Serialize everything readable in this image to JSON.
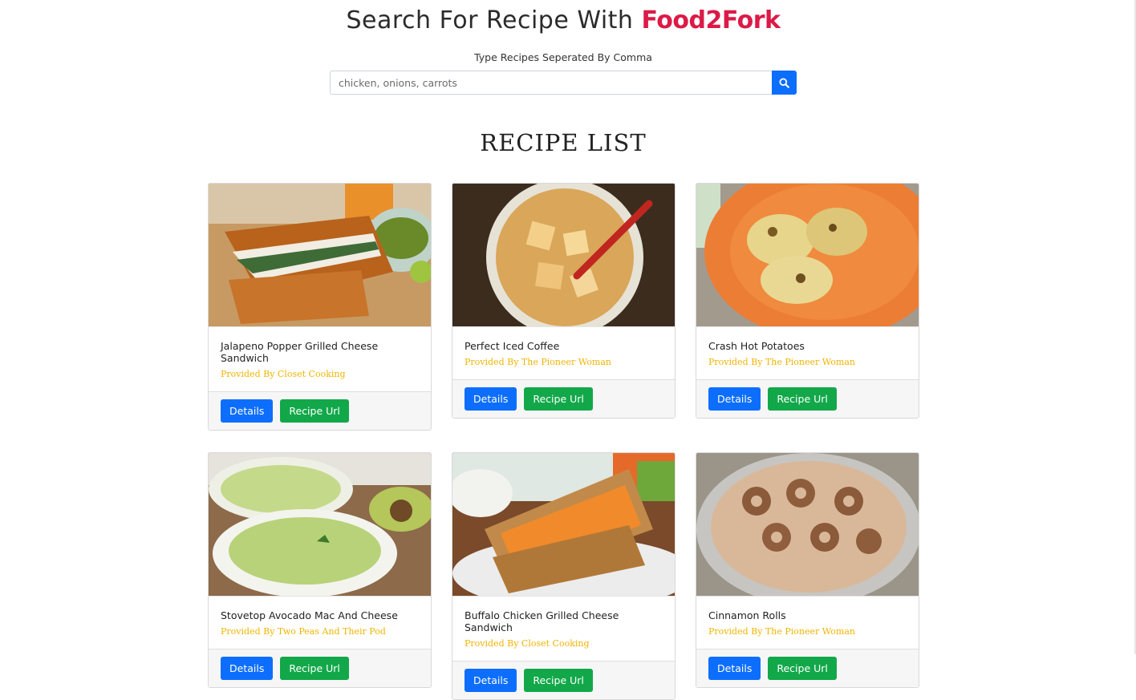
{
  "header": {
    "title_prefix": "Search For Recipe With",
    "brand": "Food2Fork",
    "search_label": "Type Recipes Seperated By Comma",
    "search_placeholder": "chicken, onions, carrots",
    "search_icon": "search-icon"
  },
  "list_title": "RECIPE LIST",
  "recipes": [
    {
      "title": "Jalapeno Popper Grilled Cheese Sandwich",
      "publisher": "Provided By Closet Cooking",
      "details_label": "Details",
      "url_label": "Recipe Url"
    },
    {
      "title": "Perfect Iced Coffee",
      "publisher": "Provided By The Pioneer Woman",
      "details_label": "Details",
      "url_label": "Recipe Url"
    },
    {
      "title": "Crash Hot Potatoes",
      "publisher": "Provided By The Pioneer Woman",
      "details_label": "Details",
      "url_label": "Recipe Url"
    },
    {
      "title": "Stovetop Avocado Mac And Cheese",
      "publisher": "Provided By Two Peas And Their Pod",
      "details_label": "Details",
      "url_label": "Recipe Url"
    },
    {
      "title": "Buffalo Chicken Grilled Cheese Sandwich",
      "publisher": "Provided By Closet Cooking",
      "details_label": "Details",
      "url_label": "Recipe Url"
    },
    {
      "title": "Cinnamon Rolls",
      "publisher": "Provided By The Pioneer Woman",
      "details_label": "Details",
      "url_label": "Recipe Url"
    }
  ],
  "colors": {
    "brand": "#dc1a47",
    "primary_button": "#0d6efd",
    "success_button": "#12a84a",
    "publisher_text": "#f0b400"
  }
}
